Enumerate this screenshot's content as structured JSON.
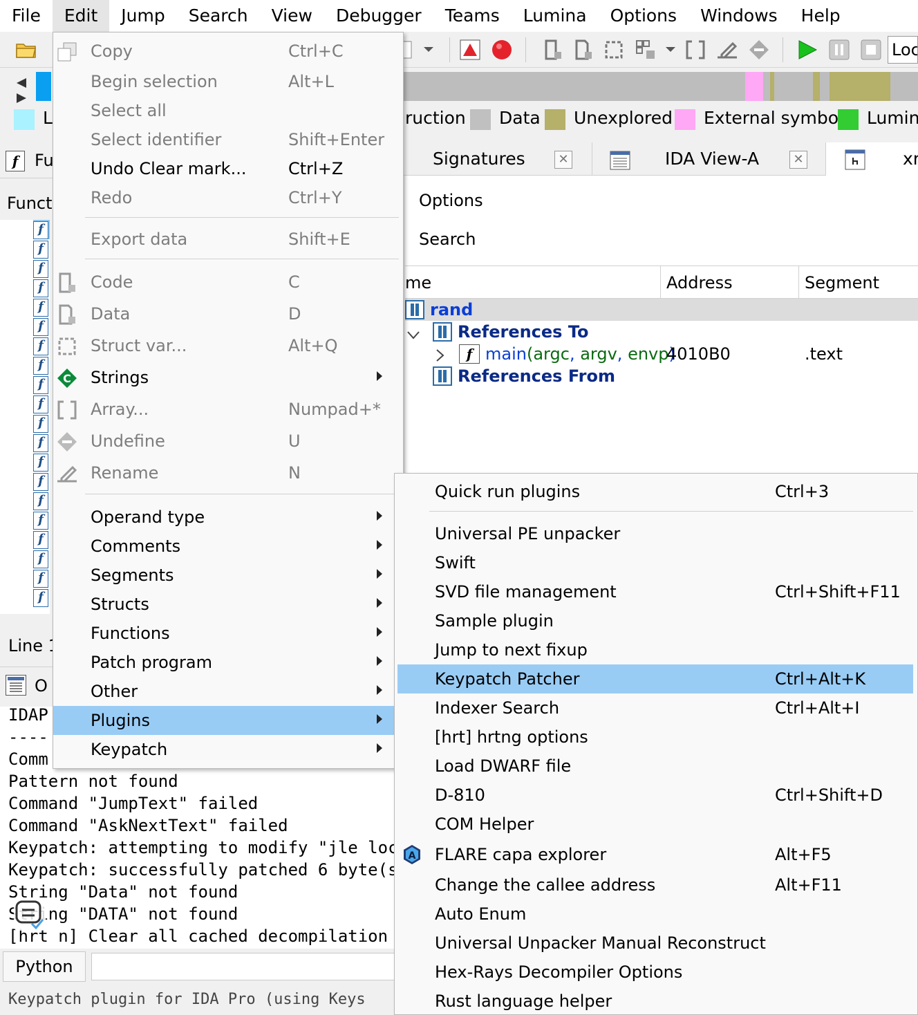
{
  "menubar": {
    "items": [
      "File",
      "Edit",
      "Jump",
      "Search",
      "View",
      "Debugger",
      "Teams",
      "Lumina",
      "Options",
      "Windows",
      "Help"
    ]
  },
  "toolbar": {
    "location_field": "Loc",
    "icons": [
      "open-folder-icon",
      "graph-icon",
      "breakpoint-icon",
      "code-icon",
      "data-icon",
      "struct-icon",
      "array-icon",
      "rename-icon",
      "undefine-icon",
      "run-icon",
      "pause-icon",
      "stop-icon"
    ]
  },
  "legend": {
    "items": [
      {
        "label": "L",
        "color": "#aaf2ff"
      },
      {
        "label": "ruction",
        "color": null
      },
      {
        "label": "Data",
        "color": "#c0c0c0"
      },
      {
        "label": "Unexplored",
        "color": "#b5b06a"
      },
      {
        "label": "External symbol",
        "color": "#ffa8f5"
      },
      {
        "label": "Lumina",
        "color": "#33cc33"
      }
    ]
  },
  "tabs": {
    "signatures": "Signatures",
    "ida_view": "IDA View-A",
    "xrefs": "xr"
  },
  "xrefs_panel": {
    "options_label": "Options",
    "search_label": "Search",
    "columns": {
      "name": "me",
      "address": "Address",
      "segment": "Segment"
    },
    "root": "rand",
    "references_to": "References To",
    "ref_row": {
      "name": "main",
      "open_paren": "(",
      "arg1": "argc",
      "comma1": ", ",
      "arg2": "argv",
      "comma2": ", ",
      "arg3": "envp",
      "close_paren": ")",
      "address": "4010B0",
      "segment": ".text"
    },
    "references_from": "References From"
  },
  "left_pane": {
    "functions_tab": "Fu",
    "functions_header": "Funct",
    "line_label": "Line 1",
    "output_tab": "O"
  },
  "output": {
    "lines": [
      "IDAP",
      "----",
      "Comm",
      "Pattern not found",
      "Command \"JumpText\" failed",
      "Command \"AskNextText\" failed",
      "Keypatch: attempting to modify \"jle loc",
      "Keypatch: successfully patched 6 byte(s",
      "String \"Data\" not found",
      "String \"DATA\" not found",
      "[hrt n] Clear all cached decompilation"
    ]
  },
  "python_bar": {
    "label": "Python"
  },
  "status_bar": {
    "text": "Keypatch plugin for IDA Pro (using Keys"
  },
  "edit_menu": {
    "items": [
      {
        "label": "Copy",
        "shortcut": "Ctrl+C",
        "enabled": false,
        "icon": "copy-icon"
      },
      {
        "label": "Begin selection",
        "shortcut": "Alt+L",
        "enabled": false
      },
      {
        "label": "Select all",
        "shortcut": "",
        "enabled": false
      },
      {
        "label": "Select identifier",
        "shortcut": "Shift+Enter",
        "enabled": false
      },
      {
        "label": "Undo Clear mark...",
        "shortcut": "Ctrl+Z",
        "enabled": true
      },
      {
        "label": "Redo",
        "shortcut": "Ctrl+Y",
        "enabled": false
      },
      {
        "label": "Export data",
        "shortcut": "Shift+E",
        "enabled": false
      },
      {
        "label": "Code",
        "shortcut": "C",
        "enabled": false,
        "icon": "code-icon"
      },
      {
        "label": "Data",
        "shortcut": "D",
        "enabled": false,
        "icon": "data-icon"
      },
      {
        "label": "Struct var...",
        "shortcut": "Alt+Q",
        "enabled": false,
        "icon": "struct-icon"
      },
      {
        "label": "Strings",
        "shortcut": "",
        "enabled": true,
        "icon": "strings-icon",
        "submenu": true
      },
      {
        "label": "Array...",
        "shortcut": "Numpad+*",
        "enabled": false,
        "icon": "array-icon"
      },
      {
        "label": "Undefine",
        "shortcut": "U",
        "enabled": false,
        "icon": "undefine-icon"
      },
      {
        "label": "Rename",
        "shortcut": "N",
        "enabled": false,
        "icon": "rename-icon"
      },
      {
        "label": "Operand type",
        "enabled": true,
        "submenu": true
      },
      {
        "label": "Comments",
        "enabled": true,
        "submenu": true
      },
      {
        "label": "Segments",
        "enabled": true,
        "submenu": true
      },
      {
        "label": "Structs",
        "enabled": true,
        "submenu": true
      },
      {
        "label": "Functions",
        "enabled": true,
        "submenu": true
      },
      {
        "label": "Patch program",
        "enabled": true,
        "submenu": true
      },
      {
        "label": "Other",
        "enabled": true,
        "submenu": true
      },
      {
        "label": "Plugins",
        "enabled": true,
        "submenu": true,
        "selected": true
      },
      {
        "label": "Keypatch",
        "enabled": true,
        "submenu": true
      }
    ]
  },
  "plugins_menu": {
    "items": [
      {
        "label": "Quick run plugins",
        "shortcut": "Ctrl+3"
      },
      {
        "label": "Universal PE unpacker",
        "shortcut": ""
      },
      {
        "label": "Swift",
        "shortcut": ""
      },
      {
        "label": "SVD file management",
        "shortcut": "Ctrl+Shift+F11"
      },
      {
        "label": "Sample plugin",
        "shortcut": ""
      },
      {
        "label": "Jump to next fixup",
        "shortcut": ""
      },
      {
        "label": "Keypatch Patcher",
        "shortcut": "Ctrl+Alt+K",
        "selected": true
      },
      {
        "label": "Indexer Search",
        "shortcut": "Ctrl+Alt+I"
      },
      {
        "label": "[hrt] hrtng options",
        "shortcut": ""
      },
      {
        "label": "Load DWARF file",
        "shortcut": ""
      },
      {
        "label": "D-810",
        "shortcut": "Ctrl+Shift+D"
      },
      {
        "label": "COM Helper",
        "shortcut": ""
      },
      {
        "label": "FLARE capa explorer",
        "shortcut": "Alt+F5",
        "icon": "capa-icon"
      },
      {
        "label": "Change the callee address",
        "shortcut": "Alt+F11"
      },
      {
        "label": "Auto Enum",
        "shortcut": ""
      },
      {
        "label": "Universal Unpacker Manual Reconstruct",
        "shortcut": ""
      },
      {
        "label": "Hex-Rays Decompiler Options",
        "shortcut": ""
      },
      {
        "label": "Rust language helper",
        "shortcut": ""
      }
    ]
  }
}
